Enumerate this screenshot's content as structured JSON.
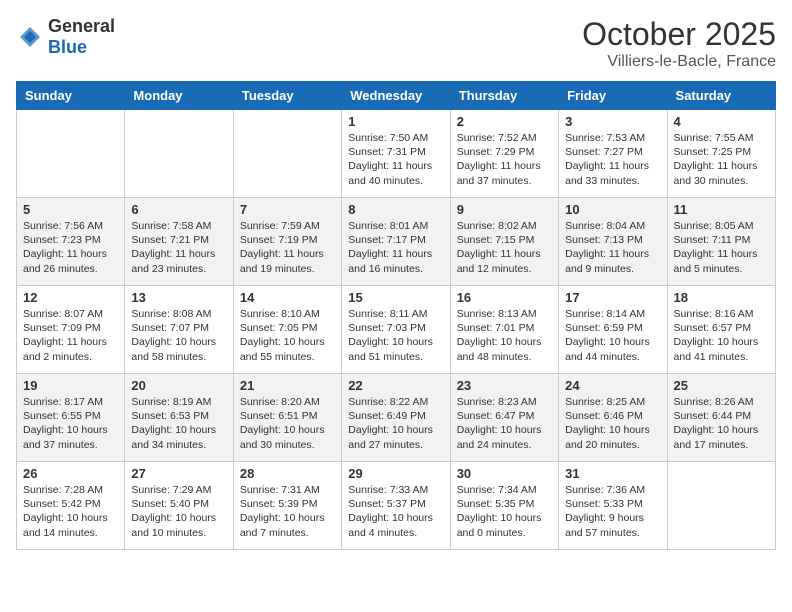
{
  "header": {
    "logo_general": "General",
    "logo_blue": "Blue",
    "title": "October 2025",
    "subtitle": "Villiers-le-Bacle, France"
  },
  "weekdays": [
    "Sunday",
    "Monday",
    "Tuesday",
    "Wednesday",
    "Thursday",
    "Friday",
    "Saturday"
  ],
  "weeks": [
    [
      {
        "day": "",
        "sunrise": "",
        "sunset": "",
        "daylight": ""
      },
      {
        "day": "",
        "sunrise": "",
        "sunset": "",
        "daylight": ""
      },
      {
        "day": "",
        "sunrise": "",
        "sunset": "",
        "daylight": ""
      },
      {
        "day": "1",
        "sunrise": "Sunrise: 7:50 AM",
        "sunset": "Sunset: 7:31 PM",
        "daylight": "Daylight: 11 hours and 40 minutes."
      },
      {
        "day": "2",
        "sunrise": "Sunrise: 7:52 AM",
        "sunset": "Sunset: 7:29 PM",
        "daylight": "Daylight: 11 hours and 37 minutes."
      },
      {
        "day": "3",
        "sunrise": "Sunrise: 7:53 AM",
        "sunset": "Sunset: 7:27 PM",
        "daylight": "Daylight: 11 hours and 33 minutes."
      },
      {
        "day": "4",
        "sunrise": "Sunrise: 7:55 AM",
        "sunset": "Sunset: 7:25 PM",
        "daylight": "Daylight: 11 hours and 30 minutes."
      }
    ],
    [
      {
        "day": "5",
        "sunrise": "Sunrise: 7:56 AM",
        "sunset": "Sunset: 7:23 PM",
        "daylight": "Daylight: 11 hours and 26 minutes."
      },
      {
        "day": "6",
        "sunrise": "Sunrise: 7:58 AM",
        "sunset": "Sunset: 7:21 PM",
        "daylight": "Daylight: 11 hours and 23 minutes."
      },
      {
        "day": "7",
        "sunrise": "Sunrise: 7:59 AM",
        "sunset": "Sunset: 7:19 PM",
        "daylight": "Daylight: 11 hours and 19 minutes."
      },
      {
        "day": "8",
        "sunrise": "Sunrise: 8:01 AM",
        "sunset": "Sunset: 7:17 PM",
        "daylight": "Daylight: 11 hours and 16 minutes."
      },
      {
        "day": "9",
        "sunrise": "Sunrise: 8:02 AM",
        "sunset": "Sunset: 7:15 PM",
        "daylight": "Daylight: 11 hours and 12 minutes."
      },
      {
        "day": "10",
        "sunrise": "Sunrise: 8:04 AM",
        "sunset": "Sunset: 7:13 PM",
        "daylight": "Daylight: 11 hours and 9 minutes."
      },
      {
        "day": "11",
        "sunrise": "Sunrise: 8:05 AM",
        "sunset": "Sunset: 7:11 PM",
        "daylight": "Daylight: 11 hours and 5 minutes."
      }
    ],
    [
      {
        "day": "12",
        "sunrise": "Sunrise: 8:07 AM",
        "sunset": "Sunset: 7:09 PM",
        "daylight": "Daylight: 11 hours and 2 minutes."
      },
      {
        "day": "13",
        "sunrise": "Sunrise: 8:08 AM",
        "sunset": "Sunset: 7:07 PM",
        "daylight": "Daylight: 10 hours and 58 minutes."
      },
      {
        "day": "14",
        "sunrise": "Sunrise: 8:10 AM",
        "sunset": "Sunset: 7:05 PM",
        "daylight": "Daylight: 10 hours and 55 minutes."
      },
      {
        "day": "15",
        "sunrise": "Sunrise: 8:11 AM",
        "sunset": "Sunset: 7:03 PM",
        "daylight": "Daylight: 10 hours and 51 minutes."
      },
      {
        "day": "16",
        "sunrise": "Sunrise: 8:13 AM",
        "sunset": "Sunset: 7:01 PM",
        "daylight": "Daylight: 10 hours and 48 minutes."
      },
      {
        "day": "17",
        "sunrise": "Sunrise: 8:14 AM",
        "sunset": "Sunset: 6:59 PM",
        "daylight": "Daylight: 10 hours and 44 minutes."
      },
      {
        "day": "18",
        "sunrise": "Sunrise: 8:16 AM",
        "sunset": "Sunset: 6:57 PM",
        "daylight": "Daylight: 10 hours and 41 minutes."
      }
    ],
    [
      {
        "day": "19",
        "sunrise": "Sunrise: 8:17 AM",
        "sunset": "Sunset: 6:55 PM",
        "daylight": "Daylight: 10 hours and 37 minutes."
      },
      {
        "day": "20",
        "sunrise": "Sunrise: 8:19 AM",
        "sunset": "Sunset: 6:53 PM",
        "daylight": "Daylight: 10 hours and 34 minutes."
      },
      {
        "day": "21",
        "sunrise": "Sunrise: 8:20 AM",
        "sunset": "Sunset: 6:51 PM",
        "daylight": "Daylight: 10 hours and 30 minutes."
      },
      {
        "day": "22",
        "sunrise": "Sunrise: 8:22 AM",
        "sunset": "Sunset: 6:49 PM",
        "daylight": "Daylight: 10 hours and 27 minutes."
      },
      {
        "day": "23",
        "sunrise": "Sunrise: 8:23 AM",
        "sunset": "Sunset: 6:47 PM",
        "daylight": "Daylight: 10 hours and 24 minutes."
      },
      {
        "day": "24",
        "sunrise": "Sunrise: 8:25 AM",
        "sunset": "Sunset: 6:46 PM",
        "daylight": "Daylight: 10 hours and 20 minutes."
      },
      {
        "day": "25",
        "sunrise": "Sunrise: 8:26 AM",
        "sunset": "Sunset: 6:44 PM",
        "daylight": "Daylight: 10 hours and 17 minutes."
      }
    ],
    [
      {
        "day": "26",
        "sunrise": "Sunrise: 7:28 AM",
        "sunset": "Sunset: 5:42 PM",
        "daylight": "Daylight: 10 hours and 14 minutes."
      },
      {
        "day": "27",
        "sunrise": "Sunrise: 7:29 AM",
        "sunset": "Sunset: 5:40 PM",
        "daylight": "Daylight: 10 hours and 10 minutes."
      },
      {
        "day": "28",
        "sunrise": "Sunrise: 7:31 AM",
        "sunset": "Sunset: 5:39 PM",
        "daylight": "Daylight: 10 hours and 7 minutes."
      },
      {
        "day": "29",
        "sunrise": "Sunrise: 7:33 AM",
        "sunset": "Sunset: 5:37 PM",
        "daylight": "Daylight: 10 hours and 4 minutes."
      },
      {
        "day": "30",
        "sunrise": "Sunrise: 7:34 AM",
        "sunset": "Sunset: 5:35 PM",
        "daylight": "Daylight: 10 hours and 0 minutes."
      },
      {
        "day": "31",
        "sunrise": "Sunrise: 7:36 AM",
        "sunset": "Sunset: 5:33 PM",
        "daylight": "Daylight: 9 hours and 57 minutes."
      },
      {
        "day": "",
        "sunrise": "",
        "sunset": "",
        "daylight": ""
      }
    ]
  ]
}
